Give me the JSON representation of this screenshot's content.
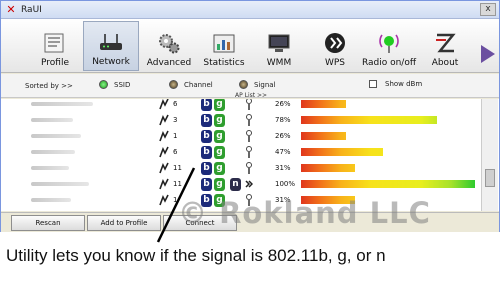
{
  "window": {
    "title": "RaUI",
    "close_glyph": "x"
  },
  "toolbar": {
    "items": [
      {
        "label": "Profile",
        "icon": "profile-icon"
      },
      {
        "label": "Network",
        "icon": "router-icon"
      },
      {
        "label": "Advanced",
        "icon": "gears-icon"
      },
      {
        "label": "Statistics",
        "icon": "statistics-icon"
      },
      {
        "label": "WMM",
        "icon": "wmm-icon"
      },
      {
        "label": "WPS",
        "icon": "wps-icon"
      },
      {
        "label": "Radio on/off",
        "icon": "radio-icon"
      },
      {
        "label": "About",
        "icon": "about-icon"
      }
    ],
    "active_index": 1
  },
  "sortbar": {
    "sorted_by": "Sorted by >>",
    "ssid": "SSID",
    "channel": "Channel",
    "signal": "Signal",
    "show_dbm": "Show dBm",
    "ap_list": "AP List >>"
  },
  "networks": [
    {
      "channel": "6",
      "b": true,
      "g": true,
      "n": false,
      "signal_text": "26%",
      "signal": 26
    },
    {
      "channel": "3",
      "b": true,
      "g": true,
      "n": false,
      "signal_text": "78%",
      "signal": 78
    },
    {
      "channel": "1",
      "b": true,
      "g": true,
      "n": false,
      "signal_text": "26%",
      "signal": 26
    },
    {
      "channel": "6",
      "b": true,
      "g": true,
      "n": false,
      "signal_text": "47%",
      "signal": 47
    },
    {
      "channel": "11",
      "b": true,
      "g": true,
      "n": false,
      "signal_text": "31%",
      "signal": 31
    },
    {
      "channel": "11",
      "b": true,
      "g": true,
      "n": true,
      "signal_text": "100%",
      "signal": 100
    },
    {
      "channel": "1",
      "b": true,
      "g": true,
      "n": false,
      "signal_text": "31%",
      "signal": 31
    }
  ],
  "badges": {
    "b": "b",
    "g": "g",
    "n": "n"
  },
  "buttons": {
    "rescan": "Rescan",
    "add_to_profile": "Add to Profile",
    "connect": "Connect"
  },
  "watermark": "© Rokland LLC",
  "caption": "Utility lets you know if the signal is 802.11b, g, or n",
  "colors": {
    "accent": "#7a96df",
    "b_badge": "#1c2a7a",
    "g_badge": "#2f9e2f",
    "n_badge": "#2c2c4a"
  }
}
